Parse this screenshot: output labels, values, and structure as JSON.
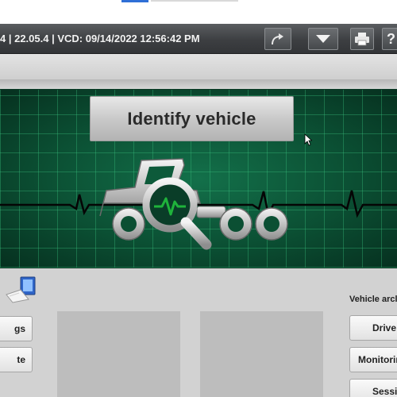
{
  "window": {
    "title": "4 | 22.05.4 | VCD: 09/14/2022 12:56:42 PM",
    "buttons": [
      {
        "name": "forward-arrow-icon"
      },
      {
        "name": "dropdown-arrow-icon"
      },
      {
        "name": "print-icon"
      },
      {
        "name": "help-icon",
        "glyph": "?"
      }
    ]
  },
  "main": {
    "identify_label": "Identify vehicle",
    "vehicle_icon": "vehicle-diagnosis-icon"
  },
  "left_panel": {
    "icon": "pc-icon",
    "buttons": [
      "gs",
      "te"
    ]
  },
  "right_panel": {
    "section_label": "Vehicle arcl",
    "buttons": [
      "Drive",
      "Monitorin",
      "Sessi"
    ]
  },
  "colors": {
    "titlebar": "#3d3f42",
    "ecg_background": "#0b4f33",
    "ecg_line": "#0a0a0a",
    "accent_green": "#1fb33b"
  }
}
